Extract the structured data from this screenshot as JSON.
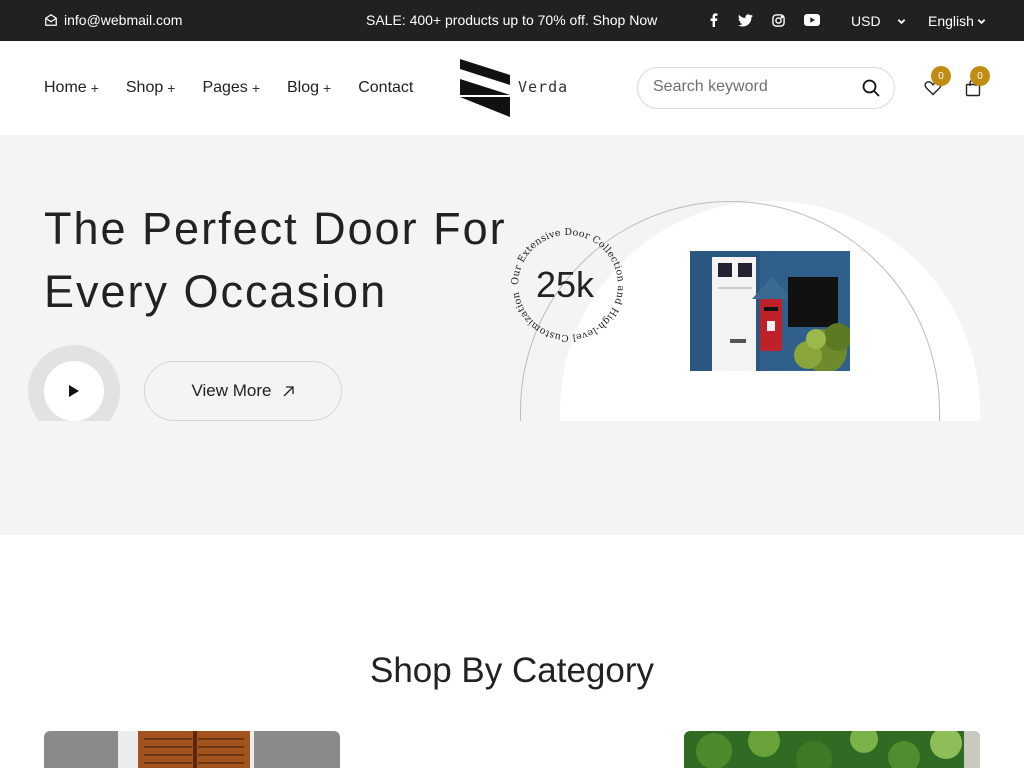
{
  "topbar": {
    "email": "info@webmail.com",
    "sale": "SALE: 400+ products up to 70% off. Shop Now",
    "social": [
      "facebook-icon",
      "twitter-icon",
      "instagram-icon",
      "youtube-icon"
    ],
    "currency": "USD",
    "language": "English"
  },
  "header": {
    "nav": [
      {
        "label": "Home",
        "has_sub": true
      },
      {
        "label": "Shop",
        "has_sub": true
      },
      {
        "label": "Pages",
        "has_sub": true
      },
      {
        "label": "Blog",
        "has_sub": true
      },
      {
        "label": "Contact",
        "has_sub": false
      }
    ],
    "logo_text": "Verda",
    "search_placeholder": "Search keyword",
    "wishlist_count": "0",
    "cart_count": "0"
  },
  "hero": {
    "title_line1": "The Perfect Door For",
    "title_line2": "Every Occasion",
    "view_more": "View More",
    "badge_number": "25k",
    "badge_circle_text": "Our Extensive Door Collection and High-level Customization"
  },
  "category": {
    "title": "Shop By Category"
  },
  "colors": {
    "topbar_bg": "#212121",
    "hero_bg": "#f4f4f4",
    "badge": "#c08c14"
  }
}
